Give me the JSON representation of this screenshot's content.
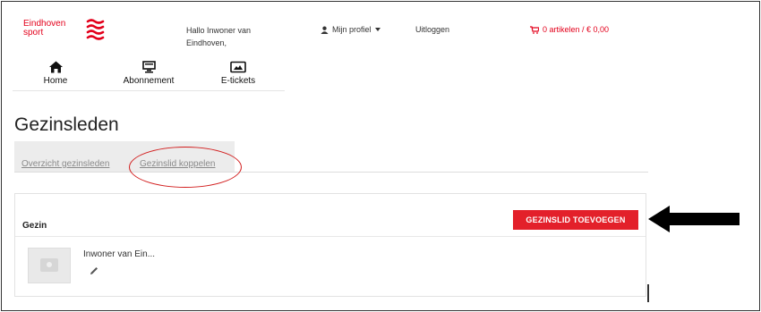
{
  "header": {
    "logo_line1": "Eindhoven",
    "logo_line2": "sport",
    "greeting": "Hallo Inwoner van Eindhoven,",
    "profile_label": "Mijn profiel",
    "logout_label": "Uitloggen",
    "cart_label": "0 artikelen / € 0,00"
  },
  "nav": {
    "items": [
      {
        "label": "Home",
        "icon": "home-icon"
      },
      {
        "label": "Abonnement",
        "icon": "monitor-icon"
      },
      {
        "label": "E-tickets",
        "icon": "ticket-icon"
      }
    ]
  },
  "page": {
    "title": "Gezinsleden"
  },
  "tabs": [
    {
      "label": "Overzicht gezinsleden"
    },
    {
      "label": "Gezinslid koppelen"
    }
  ],
  "panel": {
    "title": "Gezin",
    "add_button": "GEZINSLID TOEVOEGEN",
    "members": [
      {
        "name": "Inwoner van Ein..."
      }
    ]
  },
  "colors": {
    "brand_red": "#e3001b",
    "button_red": "#e3202a",
    "annotation_red": "#d21d1d"
  }
}
